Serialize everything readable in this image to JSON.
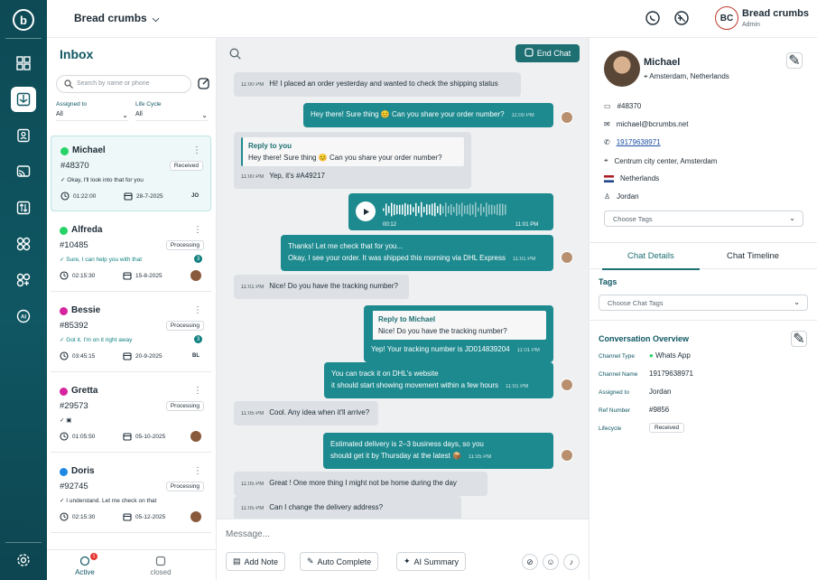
{
  "topbar": {
    "breadcrumb": "Bread crumbs",
    "user_initials": "BC",
    "user_name": "Bread crumbs",
    "user_role": "Admin"
  },
  "inbox": {
    "title": "Inbox",
    "search_placeholder": "Search by name or phone",
    "filters": [
      {
        "label": "Assigned to",
        "value": "All"
      },
      {
        "label": "Life Cycle",
        "value": "All"
      }
    ],
    "conversations": [
      {
        "name": "Michael",
        "channel": "whatsapp",
        "id": "#48370",
        "status": "Received",
        "preview": "Okay, I'll look into that for you",
        "preview_teal": false,
        "count": "",
        "time": "01:22:00",
        "date": "28-7-2025",
        "agent": "JO"
      },
      {
        "name": "Alfreda",
        "channel": "whatsapp",
        "id": "#10485",
        "status": "Processing",
        "preview": "Sure, I can help you with that",
        "preview_teal": true,
        "count": "3",
        "time": "02:15:30",
        "date": "15-8-2025",
        "agent": ""
      },
      {
        "name": "Bessie",
        "channel": "instagram",
        "id": "#85392",
        "status": "Processing",
        "preview": "Got it. I'm on it right away",
        "preview_teal": true,
        "count": "3",
        "time": "03:45:15",
        "date": "20-9-2025",
        "agent": "BL"
      },
      {
        "name": "Gretta",
        "channel": "instagram",
        "id": "#29573",
        "status": "Processing",
        "preview": "",
        "preview_teal": false,
        "count": "",
        "time": "01:05:50",
        "date": "05-10-2025",
        "agent": ""
      },
      {
        "name": "Doris",
        "channel": "messenger",
        "id": "#92745",
        "status": "Processing",
        "preview": "I understand. Let me check on that",
        "preview_teal": false,
        "count": "",
        "time": "02:15:30",
        "date": "05-12-2025",
        "agent": ""
      }
    ],
    "tabs": {
      "active": "Active",
      "active_badge": "1",
      "closed": "closed"
    }
  },
  "chat": {
    "end_chat": "End Chat",
    "messages": {
      "m1": {
        "time": "11:00 PM",
        "text": "Hi! I placed an order yesterday and wanted to check the shipping status"
      },
      "m2": {
        "text": "Hey there! Sure thing 😊 Can you share your order number?",
        "time": "11:00 PM"
      },
      "m3": {
        "reply_title": "Reply to you",
        "reply_text": "Hey there! Sure thing 😊 Can you share your order number?",
        "time": "11:00 PM",
        "text": "Yep, it's #A49217"
      },
      "m4": {
        "duration": "00:12",
        "time": "11:01 PM"
      },
      "m5": {
        "line1": "Thanks! Let me check that for you...",
        "line2": "Okay, I see your order. It was shipped this morning via DHL Express",
        "time": "11:01 PM"
      },
      "m6": {
        "time": "11:01 PM",
        "text": "Nice! Do you have the tracking number?"
      },
      "m7": {
        "reply_title": "Reply to Michael",
        "reply_text": "Nice! Do you have the tracking number?",
        "text": "Yep! Your tracking number is JD014839204",
        "time": "11:01 PM"
      },
      "m8": {
        "line1": "You can track it on DHL's website",
        "line2": "it should start showing movement within a few hours",
        "time": "11:01 PM"
      },
      "m9": {
        "time": "11:05 PM",
        "text": "Cool. Any idea when it'll arrive?"
      },
      "m10": {
        "line1": "Estimated delivery is 2–3 business days, so you",
        "line2": "should get it by Thursday at the latest 📦",
        "time": "11:05 PM"
      },
      "m11": {
        "time": "11:05 PM",
        "text": "Great ! One more thing I might not be home during the day"
      },
      "m12": {
        "time": "11:05 PM",
        "text": "Can I change the delivery address?"
      }
    },
    "composer": {
      "placeholder": "Message...",
      "add_note": "Add Note",
      "auto_complete": "Auto Complete",
      "ai_summary": "AI Summary"
    }
  },
  "details": {
    "name": "Michael",
    "location": "Amsterdam, Netherlands",
    "id": "#48370",
    "email": "michael@bcrumbs.net",
    "phone": "19179638971",
    "address": "Centrum city center, Amsterdam",
    "country": "Netherlands",
    "agent": "Jordan",
    "tags_placeholder": "Choose Tags",
    "tabs": [
      "Chat Details",
      "Chat Timeline"
    ],
    "tags_title": "Tags",
    "chat_tags_placeholder": "Choose Chat Tags",
    "overview_title": "Conversation Overview",
    "overview": {
      "channel_type_label": "Channel Type",
      "channel_type": "Whats App",
      "channel_name_label": "Channel Name",
      "channel_name": "19179638971",
      "assigned_label": "Assigned to",
      "assigned": "Jordan",
      "ref_label": "Ref Number",
      "ref": "#9856",
      "lifecycle_label": "Lifecycle",
      "lifecycle": "Received"
    }
  },
  "colors": {
    "brand": "#0f5763",
    "bubble_out": "#1d8a8f",
    "bubble_in": "#dde1e5",
    "whatsapp": "#25d366",
    "instagram": "#d6249f",
    "messenger": "#1e88e5"
  }
}
